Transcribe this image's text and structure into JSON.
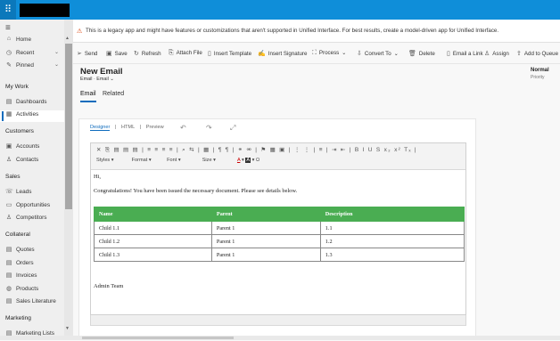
{
  "sidebar": {
    "items_top": [
      {
        "label": "Home",
        "icon": "home-icon",
        "glyph": "⌂"
      },
      {
        "label": "Recent",
        "icon": "clock-icon",
        "glyph": "◷",
        "chevron": "⌄"
      },
      {
        "label": "Pinned",
        "icon": "pin-icon",
        "glyph": "✎",
        "chevron": "⌄"
      }
    ],
    "sections": [
      {
        "title": "My Work",
        "items": [
          {
            "label": "Dashboards",
            "icon": "dashboard-icon",
            "glyph": "▤"
          },
          {
            "label": "Activities",
            "icon": "activities-icon",
            "glyph": "▦",
            "active": true
          }
        ]
      },
      {
        "title": "Customers",
        "items": [
          {
            "label": "Accounts",
            "icon": "accounts-icon",
            "glyph": "▣"
          },
          {
            "label": "Contacts",
            "icon": "contacts-icon",
            "glyph": "♙"
          }
        ]
      },
      {
        "title": "Sales",
        "items": [
          {
            "label": "Leads",
            "icon": "leads-icon",
            "glyph": "☏"
          },
          {
            "label": "Opportunities",
            "icon": "opportunities-icon",
            "glyph": "▭"
          },
          {
            "label": "Competitors",
            "icon": "competitors-icon",
            "glyph": "♙"
          }
        ]
      },
      {
        "title": "Collateral",
        "items": [
          {
            "label": "Quotes",
            "icon": "quotes-icon",
            "glyph": "▤"
          },
          {
            "label": "Orders",
            "icon": "orders-icon",
            "glyph": "▤"
          },
          {
            "label": "Invoices",
            "icon": "invoices-icon",
            "glyph": "▤"
          },
          {
            "label": "Products",
            "icon": "products-icon",
            "glyph": "◍"
          },
          {
            "label": "Sales Literature",
            "icon": "literature-icon",
            "glyph": "▤"
          }
        ]
      },
      {
        "title": "Marketing",
        "items": [
          {
            "label": "Marketing Lists",
            "icon": "marketing-list-icon",
            "glyph": "▤"
          }
        ]
      }
    ]
  },
  "banner": {
    "message": "This is a legacy app and might have features or customizations that aren't supported in Unified Interface. For best results, create a model-driven app for Unified Interface.",
    "warn_glyph": "⚠"
  },
  "commands": [
    {
      "label": "Send",
      "icon": "send-icon",
      "glyph": "➢"
    },
    {
      "label": "Save",
      "icon": "save-icon",
      "glyph": "▣"
    },
    {
      "label": "Refresh",
      "icon": "refresh-icon",
      "glyph": "↻"
    },
    {
      "label": "Attach File",
      "icon": "attach-icon",
      "glyph": "⎘"
    },
    {
      "label": "Insert Template",
      "icon": "template-icon",
      "glyph": "▯"
    },
    {
      "label": "Insert Signature",
      "icon": "signature-icon",
      "glyph": "✍"
    },
    {
      "label": "Process",
      "icon": "process-icon",
      "glyph": "⛶",
      "chevron": "⌄"
    },
    {
      "label": "Convert To",
      "icon": "convert-icon",
      "glyph": "⇩",
      "chevron": "⌄"
    },
    {
      "label": "Delete",
      "icon": "delete-icon",
      "glyph": "🗑"
    },
    {
      "label": "Email a Link",
      "icon": "email-link-icon",
      "glyph": "▯"
    },
    {
      "label": "Assign",
      "icon": "assign-icon",
      "glyph": "♙"
    },
    {
      "label": "Add to Queue",
      "icon": "queue-icon",
      "glyph": "⇪"
    }
  ],
  "record": {
    "title": "New Email",
    "entity": "Email",
    "form": "Email",
    "sep": "·",
    "chevron": "⌄",
    "priority_value": "Normal",
    "priority_label": "Priority"
  },
  "tabs": [
    {
      "label": "Email",
      "selected": true
    },
    {
      "label": "Related",
      "selected": false
    }
  ],
  "editor": {
    "modes": [
      "Designer",
      "HTML",
      "Preview"
    ],
    "mode_sep": "|",
    "undo_glyph": "↶",
    "redo_glyph": "↷",
    "expand_glyph": "⤢",
    "toolbar_row1": "✕ ⎘ ▤ ▤ ▤ | ≡ ≡ ≡ ≡ | ⌕ ⇆ | ▦ | ¶ ¶ | ⚭ ⚮ | ⚑ ▦ ▣ | ⋮ ⋮ | ≡ | ⇥ ⇤ | B I U S x₂ x² Tₓ |",
    "styles": "Styles",
    "format": "Format",
    "font": "Font",
    "size": "Size",
    "color_text": "A",
    "bg_text": "A",
    "omega": "Ω",
    "dd_glyph": "▾",
    "greeting": "Hi,",
    "intro": "Congratulations! You have been issued the necessary document. Please see details below.",
    "signature": "Admin Team",
    "table": {
      "headers": [
        "Name",
        "Parent",
        "Description"
      ],
      "rows": [
        [
          "Child 1.1",
          "Parent 1",
          "1.1"
        ],
        [
          "Child 1.2",
          "Parent 1",
          "1.2"
        ],
        [
          "Child 1.3",
          "Parent 1",
          "1.3"
        ]
      ]
    }
  },
  "colors": {
    "topbar": "#0f8ed9",
    "accent": "#0f6cbd",
    "table_header": "#4aad52",
    "warning": "#d83b01"
  },
  "glyphs": {
    "waffle": "⠿",
    "hamburger": "≡",
    "scroll_up": "▲",
    "scroll_down": "▼"
  }
}
